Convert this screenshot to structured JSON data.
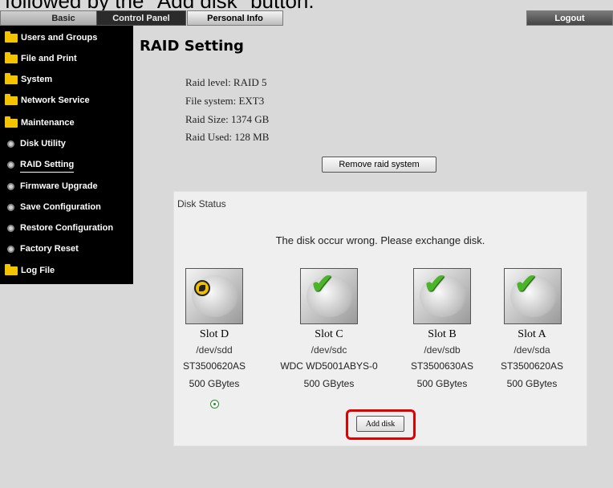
{
  "caption": "followed by the \"Add disk\" button.",
  "tabs": {
    "basic": "Basic",
    "control_panel": "Control Panel",
    "personal_info": "Personal Info",
    "logout": "Logout"
  },
  "sidebar": {
    "items": [
      {
        "label": "Users and Groups",
        "icon": "folder-icon"
      },
      {
        "label": "File and Print",
        "icon": "folder-icon"
      },
      {
        "label": "System",
        "icon": "folder-icon"
      },
      {
        "label": "Network Service",
        "icon": "folder-icon"
      },
      {
        "label": "Maintenance",
        "icon": "folder-icon"
      },
      {
        "label": "Disk Utility",
        "icon": "bullet-icon"
      },
      {
        "label": "RAID Setting",
        "icon": "bullet-icon",
        "active": true
      },
      {
        "label": "Firmware Upgrade",
        "icon": "bullet-icon"
      },
      {
        "label": "Save Configuration",
        "icon": "bullet-icon"
      },
      {
        "label": "Restore Configuration",
        "icon": "bullet-icon"
      },
      {
        "label": "Factory Reset",
        "icon": "bullet-icon"
      },
      {
        "label": "Log File",
        "icon": "folder-icon"
      }
    ]
  },
  "main": {
    "title": "RAID Setting",
    "raid_level": "Raid level:  RAID 5",
    "file_system": "File system: EXT3",
    "raid_size": "Raid Size:   1374 GB",
    "raid_used": "Raid Used:  128 MB",
    "remove_button": "Remove raid system"
  },
  "disk_status": {
    "title": "Disk Status",
    "message": "The disk occur wrong. Please exchange disk.",
    "slots": [
      {
        "name": "Slot D",
        "dev": "/dev/sdd",
        "model": "ST3500620AS",
        "size": "500 GBytes",
        "status": "warning"
      },
      {
        "name": "Slot C",
        "dev": "/dev/sdc",
        "model": "WDC WD5001ABYS-0",
        "size": "500 GBytes",
        "status": "ok"
      },
      {
        "name": "Slot B",
        "dev": "/dev/sdb",
        "model": "ST3500630AS",
        "size": "500 GBytes",
        "status": "ok"
      },
      {
        "name": "Slot A",
        "dev": "/dev/sda",
        "model": "ST3500620AS",
        "size": "500 GBytes",
        "status": "ok"
      }
    ],
    "add_button": "Add disk"
  },
  "colors": {
    "sidebar_bg": "#000000",
    "folder": "#f5c400",
    "highlight": "#e00000",
    "check": "#4bb52a"
  }
}
